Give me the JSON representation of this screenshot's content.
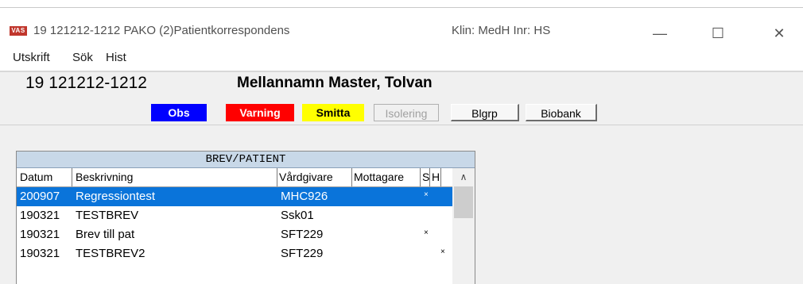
{
  "window": {
    "icon_label": "VAS",
    "title": "19 121212-1212  PAKO (2)Patientkorrespondens",
    "klin": "Klin: MedH  Inr: HS",
    "minimize_glyph": "—",
    "maximize_glyph": "☐",
    "close_glyph": "✕"
  },
  "menu": {
    "items": [
      "Utskrift",
      "Sök",
      "Hist"
    ]
  },
  "patient": {
    "personnummer": "19 121212-1212",
    "name": "Mellannamn Master, Tolvan"
  },
  "flags": {
    "obs": "Obs",
    "varning": "Varning",
    "smitta": "Smitta",
    "isolering": "Isolering",
    "blgrp": "Blgrp",
    "biobank": "Biobank",
    "colors": {
      "obs": "#0000ff",
      "varning": "#ff0000",
      "smitta": "#ffff00",
      "selection": "#0a74da",
      "header": "#c8d8e8"
    }
  },
  "letters": {
    "panel_title": "BREV/PATIENT",
    "columns": [
      "Datum",
      "Beskrivning",
      "Vårdgivare",
      "Mottagare",
      "S",
      "H"
    ],
    "rows": [
      {
        "date": "200907",
        "desc": "Regressiontest",
        "giver": "MHC926",
        "receiver": "",
        "s": "×",
        "h": "",
        "selected": true
      },
      {
        "date": "190321",
        "desc": "TESTBREV",
        "giver": "Ssk01",
        "receiver": "",
        "s": "",
        "h": "",
        "selected": false
      },
      {
        "date": "190321",
        "desc": "Brev till pat",
        "giver": "SFT229",
        "receiver": "",
        "s": "×",
        "h": "",
        "selected": false
      },
      {
        "date": "190321",
        "desc": "TESTBREV2",
        "giver": "SFT229",
        "receiver": "",
        "s": "",
        "h": "×",
        "selected": false
      }
    ],
    "scroll_up_glyph": "∧"
  }
}
